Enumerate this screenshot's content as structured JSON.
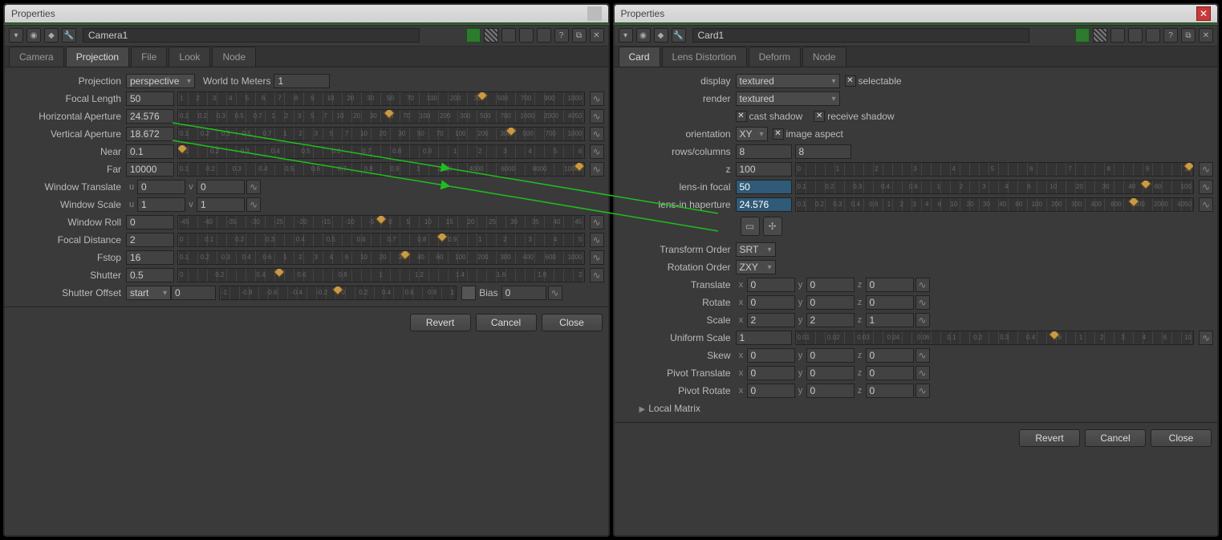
{
  "left": {
    "window_title": "Properties",
    "node_name": "Camera1",
    "tabs": [
      "Camera",
      "Projection",
      "File",
      "Look",
      "Node"
    ],
    "active_tab": 1,
    "projection": {
      "label": "Projection",
      "value": "perspective",
      "world_to_meters_label": "World to Meters",
      "world_to_meters": "1"
    },
    "focal_length": {
      "label": "Focal Length",
      "value": "50",
      "ticks": [
        "1",
        "2",
        "3",
        "4",
        "5",
        "6",
        "7",
        "8",
        "9",
        "10",
        "20",
        "30",
        "50",
        "70",
        "100",
        "200",
        "300",
        "500",
        "700",
        "900",
        "1000"
      ]
    },
    "horizontal_aperture": {
      "label": "Horizontal Aperture",
      "value": "24.576",
      "ticks": [
        "0.1",
        "0.2",
        "0.3",
        "0.5",
        "0.7",
        "1",
        "2",
        "3",
        "5",
        "7",
        "10",
        "20",
        "30",
        "50",
        "70",
        "100",
        "200",
        "300",
        "500",
        "700",
        "1000",
        "2000",
        "4050"
      ]
    },
    "vertical_aperture": {
      "label": "Vertical Aperture",
      "value": "18.672",
      "ticks": [
        "0.1",
        "0.2",
        "0.3",
        "0.5",
        "0.7",
        "1",
        "2",
        "3",
        "5",
        "7",
        "10",
        "20",
        "30",
        "50",
        "70",
        "100",
        "200",
        "300",
        "500",
        "700",
        "1000"
      ]
    },
    "near": {
      "label": "Near",
      "value": "0.1",
      "ticks": [
        "0.1",
        "0.2",
        "0.3",
        "0.4",
        "0.5",
        "0.6",
        "0.7",
        "0.8",
        "0.9",
        "1",
        "2",
        "3",
        "4",
        "5",
        "6"
      ]
    },
    "far": {
      "label": "Far",
      "value": "10000",
      "ticks": [
        "0.1",
        "0.2",
        "0.3",
        "0.4",
        "0.5",
        "0.6",
        "0.7",
        "0.8",
        "0.9",
        "1",
        "2000",
        "4000",
        "6000",
        "8000",
        "10000"
      ]
    },
    "window_translate": {
      "label": "Window Translate",
      "u": "0",
      "v": "0"
    },
    "window_scale": {
      "label": "Window Scale",
      "u": "1",
      "v": "1"
    },
    "window_roll": {
      "label": "Window Roll",
      "value": "0",
      "ticks": [
        "-45",
        "-40",
        "-35",
        "-30",
        "-25",
        "-20",
        "-15",
        "-10",
        "-5",
        "0",
        "5",
        "10",
        "15",
        "20",
        "25",
        "30",
        "35",
        "40",
        "45"
      ]
    },
    "focal_distance": {
      "label": "Focal Distance",
      "value": "2",
      "ticks": [
        "0",
        "0.1",
        "0.2",
        "0.3",
        "0.4",
        "0.5",
        "0.6",
        "0.7",
        "0.8",
        "0.9",
        "1",
        "2",
        "3",
        "4",
        "5"
      ]
    },
    "fstop": {
      "label": "Fstop",
      "value": "16",
      "ticks": [
        "0.1",
        "0.2",
        "0.3",
        "0.4",
        "0.6",
        "1",
        "2",
        "3",
        "4",
        "6",
        "10",
        "20",
        "30",
        "40",
        "60",
        "100",
        "200",
        "300",
        "400",
        "600",
        "1000"
      ]
    },
    "shutter": {
      "label": "Shutter",
      "value": "0.5",
      "ticks": [
        "0",
        "0.2",
        "0.4",
        "0.6",
        "0.8",
        "1",
        "1.2",
        "1.4",
        "1.6",
        "1.8",
        "2"
      ]
    },
    "shutter_offset": {
      "label": "Shutter Offset",
      "mode": "start",
      "value": "0",
      "bias_label": "Bias",
      "bias": "0",
      "ticks": [
        "-1",
        "-0.8",
        "-0.6",
        "-0.4",
        "-0.2",
        "0",
        "0.2",
        "0.4",
        "0.6",
        "0.8",
        "1"
      ]
    },
    "buttons": {
      "revert": "Revert",
      "cancel": "Cancel",
      "close": "Close"
    }
  },
  "right": {
    "window_title": "Properties",
    "node_name": "Card1",
    "tabs": [
      "Card",
      "Lens Distortion",
      "Deform",
      "Node"
    ],
    "active_tab": 0,
    "display": {
      "label": "display",
      "value": "textured",
      "selectable_label": "selectable"
    },
    "render": {
      "label": "render",
      "value": "textured"
    },
    "shadows": {
      "cast": "cast shadow",
      "receive": "receive shadow"
    },
    "orientation": {
      "label": "orientation",
      "value": "XY",
      "image_aspect_label": "image aspect"
    },
    "rows_cols": {
      "label": "rows/columns",
      "rows": "8",
      "cols": "8"
    },
    "z": {
      "label": "z",
      "value": "100",
      "ticks": [
        "0",
        "1",
        "2",
        "3",
        "4",
        "5",
        "6",
        "7",
        "8",
        "9",
        "10"
      ]
    },
    "lens_in_focal": {
      "label": "lens-in focal",
      "value": "50",
      "ticks": [
        "0.1",
        "0.2",
        "0.3",
        "0.4",
        "0.6",
        "1",
        "2",
        "3",
        "4",
        "6",
        "10",
        "20",
        "30",
        "40",
        "60",
        "100"
      ]
    },
    "lens_in_haperture": {
      "label": "lens-in haperture",
      "value": "24.576",
      "ticks": [
        "0.1",
        "0.2",
        "0.3",
        "0.4",
        "0.6",
        "1",
        "2",
        "3",
        "4",
        "6",
        "10",
        "20",
        "30",
        "40",
        "60",
        "100",
        "200",
        "300",
        "400",
        "600",
        "1000",
        "2000",
        "4050"
      ]
    },
    "transform_order": {
      "label": "Transform Order",
      "value": "SRT"
    },
    "rotation_order": {
      "label": "Rotation Order",
      "value": "ZXY"
    },
    "translate": {
      "label": "Translate",
      "x": "0",
      "y": "0",
      "z": "0"
    },
    "rotate": {
      "label": "Rotate",
      "x": "0",
      "y": "0",
      "z": "0"
    },
    "scale": {
      "label": "Scale",
      "x": "2",
      "y": "2",
      "z": "1"
    },
    "uniform_scale": {
      "label": "Uniform Scale",
      "value": "1",
      "ticks": [
        "0.01",
        "0.02",
        "0.03",
        "0.04",
        "0.06",
        "0.1",
        "0.2",
        "0.3",
        "0.4",
        "0.6",
        "1",
        "2",
        "3",
        "4",
        "6",
        "10"
      ]
    },
    "skew": {
      "label": "Skew",
      "x": "0",
      "y": "0",
      "z": "0"
    },
    "pivot_translate": {
      "label": "Pivot Translate",
      "x": "0",
      "y": "0",
      "z": "0"
    },
    "pivot_rotate": {
      "label": "Pivot Rotate",
      "x": "0",
      "y": "0",
      "z": "0"
    },
    "local_matrix_label": "Local Matrix",
    "buttons": {
      "revert": "Revert",
      "cancel": "Cancel",
      "close": "Close"
    }
  }
}
